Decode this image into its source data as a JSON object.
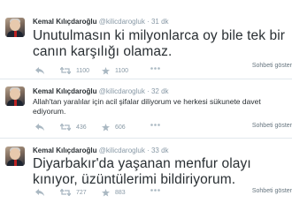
{
  "tweets": [
    {
      "name": "Kemal Kılıçdaroğlu",
      "handle": "@kilicdarogluk",
      "time": "31 dk",
      "text_lines": [
        "Unutulmasın ki milyonlarca oy bile tek bir",
        "canın karşılığı olamaz."
      ],
      "retweets": "1100",
      "favorites": "1100",
      "conversation_label": "Sohbeti göster"
    },
    {
      "name": "Kemal Kılıçdaroğlu",
      "handle": "@kilicdarogluk",
      "time": "32 dk",
      "text_lines": [
        "Allah'tan yaralılar için acil şifalar diliyorum ve herkesi sükunete davet",
        "ediyorum."
      ],
      "retweets": "436",
      "favorites": "606",
      "conversation_label": "Sohbeti göster"
    },
    {
      "name": "Kemal Kılıçdaroğlu",
      "handle": "@kilicdarogluk",
      "time": "33 dk",
      "text_lines": [
        "Diyarbakır'da yaşanan menfur olayı",
        "kınıyor, üzüntülerimi bildiriyorum."
      ],
      "retweets": "727",
      "favorites": "883",
      "conversation_label": "Sohbeti göster"
    }
  ],
  "separator": "·",
  "icons": {
    "reply": "reply-icon",
    "retweet": "retweet-icon",
    "favorite": "star-icon",
    "more": "more-icon"
  }
}
